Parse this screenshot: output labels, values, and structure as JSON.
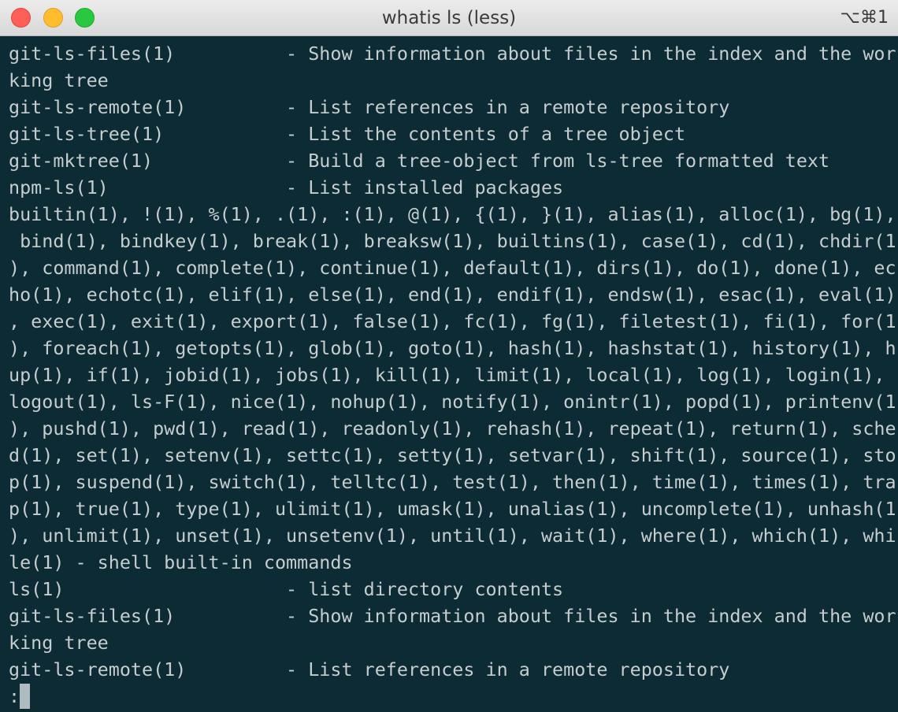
{
  "window": {
    "title": "whatis ls (less)",
    "shortcut": "⌥⌘1"
  },
  "colors": {
    "terminal_bg": "#0d2b35",
    "terminal_fg": "#c5cdcf",
    "close": "#fe5f57",
    "minimize": "#febc2e",
    "maximize": "#28c840"
  },
  "terminal": {
    "lines": [
      "git-ls-files(1)          - Show information about files in the index and the wor",
      "king tree",
      "git-ls-remote(1)         - List references in a remote repository",
      "git-ls-tree(1)           - List the contents of a tree object",
      "git-mktree(1)            - Build a tree-object from ls-tree formatted text",
      "npm-ls(1)                - List installed packages",
      "builtin(1), !(1), %(1), .(1), :(1), @(1), {(1), }(1), alias(1), alloc(1), bg(1),",
      " bind(1), bindkey(1), break(1), breaksw(1), builtins(1), case(1), cd(1), chdir(1",
      "), command(1), complete(1), continue(1), default(1), dirs(1), do(1), done(1), ec",
      "ho(1), echotc(1), elif(1), else(1), end(1), endif(1), endsw(1), esac(1), eval(1)",
      ", exec(1), exit(1), export(1), false(1), fc(1), fg(1), filetest(1), fi(1), for(1",
      "), foreach(1), getopts(1), glob(1), goto(1), hash(1), hashstat(1), history(1), h",
      "up(1), if(1), jobid(1), jobs(1), kill(1), limit(1), local(1), log(1), login(1),",
      "logout(1), ls-F(1), nice(1), nohup(1), notify(1), onintr(1), popd(1), printenv(1",
      "), pushd(1), pwd(1), read(1), readonly(1), rehash(1), repeat(1), return(1), sche",
      "d(1), set(1), setenv(1), settc(1), setty(1), setvar(1), shift(1), source(1), sto",
      "p(1), suspend(1), switch(1), telltc(1), test(1), then(1), time(1), times(1), tra",
      "p(1), true(1), type(1), ulimit(1), umask(1), unalias(1), uncomplete(1), unhash(1",
      "), unlimit(1), unset(1), unsetenv(1), until(1), wait(1), where(1), which(1), whi",
      "le(1) - shell built-in commands",
      "ls(1)                    - list directory contents",
      "git-ls-files(1)          - Show information about files in the index and the wor",
      "king tree",
      "git-ls-remote(1)         - List references in a remote repository"
    ],
    "prompt": ":"
  }
}
